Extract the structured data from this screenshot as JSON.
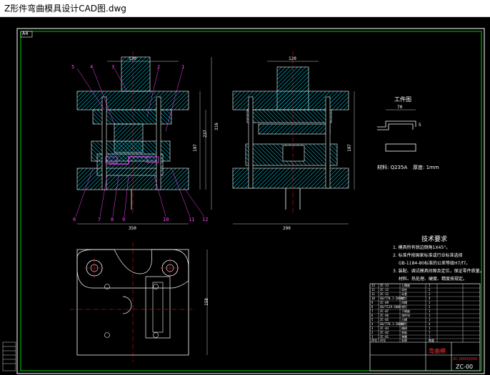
{
  "window": {
    "title": "Z形件弯曲模具设计CAD图.dwg"
  },
  "drawing": {
    "sheet_tag": "A4",
    "workpiece_title": "工件图",
    "material_line": "材料: Q235A",
    "thickness_line": "厚度: 1mm",
    "tech_title": "技术要求",
    "tech_lines": [
      "1. 模具所有锐边倒角1X45°。",
      "2. 标准件按国家标准或行业标准选择",
      "GB-1184-80标准的公差等级H7/f7。",
      "3. 装配、调试模具间隙及定位，保证零件质量。",
      "材料、热处理、硬度、精度按规定。"
    ],
    "dims": {
      "top_left": "130",
      "top_right": "120",
      "front_h1": "237",
      "front_h2": "316",
      "front_h3": "197",
      "side_h": "197",
      "front_base": "350",
      "side_base": "290",
      "plan_h": "158",
      "work_len": "70",
      "work_h": "5"
    },
    "callouts_top": [
      "5",
      "4",
      "3",
      "2",
      "1"
    ],
    "callouts_bottom": [
      "6",
      "7",
      "8",
      "9",
      "10",
      "11",
      "12"
    ],
    "title_block": {
      "name": "弯曲模",
      "code": "ZC-00",
      "red_code": "ZC-00000000"
    },
    "bom_rows": [
      {
        "no": "13",
        "code": "ZC-13",
        "name": "上模座",
        "qty": "1"
      },
      {
        "no": "12",
        "code": "ZC-12",
        "name": "导柱",
        "qty": "2"
      },
      {
        "no": "11",
        "code": "ZC-11",
        "name": "导套",
        "qty": "2"
      },
      {
        "no": "10",
        "code": "GB/T70.1-2000",
        "name": "螺钉",
        "qty": "4"
      },
      {
        "no": "9",
        "code": "ZC-09",
        "name": "凹模",
        "qty": "1"
      },
      {
        "no": "8",
        "code": "GB/T119-2000",
        "name": "销钉",
        "qty": "2"
      },
      {
        "no": "7",
        "code": "ZC-07",
        "name": "下模座",
        "qty": "1"
      },
      {
        "no": "6",
        "code": "ZC-06",
        "name": "顶件块",
        "qty": "1"
      },
      {
        "no": "5",
        "code": "ZC-05",
        "name": "凸模",
        "qty": "1"
      },
      {
        "no": "4",
        "code": "GB/T70.1-2000",
        "name": "螺钉",
        "qty": "4"
      },
      {
        "no": "3",
        "code": "ZC-03",
        "name": "模柄",
        "qty": "1"
      },
      {
        "no": "2",
        "code": "ZC-02",
        "name": "垫板",
        "qty": "1"
      },
      {
        "no": "1",
        "code": "ZC-01",
        "name": "弹簧",
        "qty": "1"
      }
    ],
    "bom_header": {
      "no": "序号",
      "code": "代号",
      "name": "名称",
      "qty": "数量"
    }
  },
  "colors": {
    "frame": "#ffffff",
    "hatch": "#00ffff",
    "outline": "#ffffff",
    "green": "#00ff00",
    "magenta": "#ff40ff",
    "red": "#ff2020",
    "yellow": "#ffff00"
  }
}
